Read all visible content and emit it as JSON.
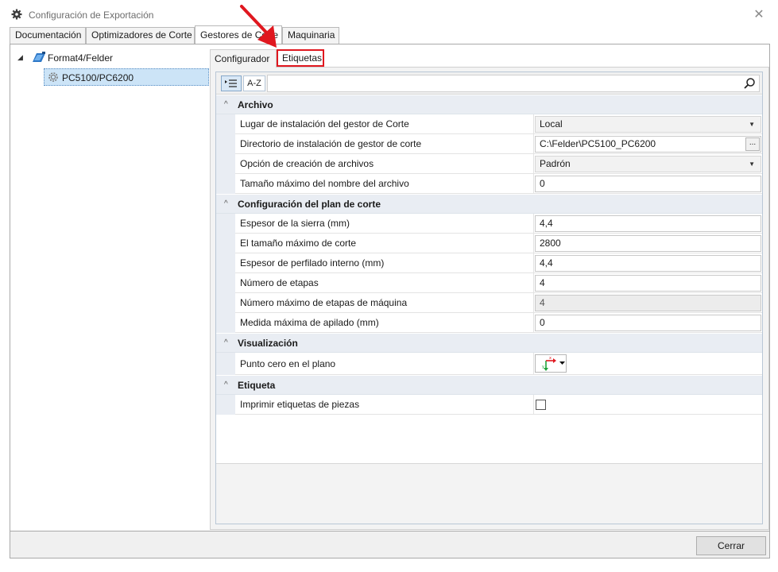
{
  "window": {
    "title": "Configuración de Exportación",
    "close_glyph": "✕",
    "icon": "gear-icon"
  },
  "main_tabs": [
    {
      "label": "Documentación"
    },
    {
      "label": "Optimizadores de Corte"
    },
    {
      "label": "Gestores de Corte"
    },
    {
      "label": "Maquinaria"
    }
  ],
  "tree": {
    "root": {
      "label": "Format4/Felder",
      "expand_glyph": "◢"
    },
    "child": {
      "label": "PC5100/PC6200"
    }
  },
  "sub_tabs": [
    {
      "label": "Configurador"
    },
    {
      "label": "Etiquetas"
    }
  ],
  "toolbar": {
    "categorized_label": "≡",
    "alpha_label": "A-Z",
    "search_placeholder": ""
  },
  "sections": [
    {
      "title": "Archivo",
      "rows": [
        {
          "name": "Lugar de instalación del gestor de Corte",
          "value": "Local",
          "kind": "dropdown"
        },
        {
          "name": "Directorio de instalación de gestor de corte",
          "value": "C:\\Felder\\PC5100_PC6200",
          "kind": "browse"
        },
        {
          "name": "Opción de creación de archivos",
          "value": "Padrón",
          "kind": "dropdown"
        },
        {
          "name": "Tamaño máximo del nombre del archivo",
          "value": "0",
          "kind": "text"
        }
      ]
    },
    {
      "title": "Configuración del plan de corte",
      "rows": [
        {
          "name": "Espesor de la sierra (mm)",
          "value": "4,4",
          "kind": "text"
        },
        {
          "name": "El tamaño máximo de corte",
          "value": "2800",
          "kind": "text"
        },
        {
          "name": "Espesor de perfilado interno (mm)",
          "value": "4,4",
          "kind": "text"
        },
        {
          "name": "Número de etapas",
          "value": "4",
          "kind": "text"
        },
        {
          "name": "Número máximo de etapas de máquina",
          "value": "4",
          "kind": "readonly"
        },
        {
          "name": "Medida máxima de apilado (mm)",
          "value": "0",
          "kind": "text"
        }
      ]
    },
    {
      "title": "Visualización",
      "rows": [
        {
          "name": "Punto cero en el plano",
          "value": "",
          "kind": "origin-picker"
        }
      ]
    },
    {
      "title": "Etiqueta",
      "rows": [
        {
          "name": "Imprimir etiquetas de piezas",
          "value": false,
          "kind": "checkbox"
        }
      ]
    }
  ],
  "glyphs": {
    "section_chevron": "^",
    "dropdown_arrow": "▼",
    "ellipsis": "..."
  },
  "footer": {
    "close_label": "Cerrar"
  },
  "colors": {
    "highlight": "#e0171f",
    "selection": "#cce4f7",
    "category_bg": "#e9edf3"
  }
}
